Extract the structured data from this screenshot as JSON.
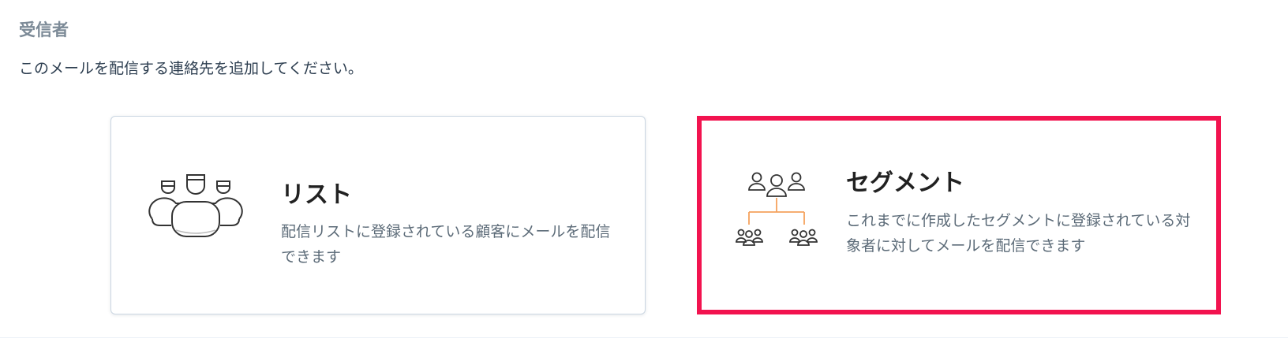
{
  "section": {
    "title": "受信者",
    "description": "このメールを配信する連絡先を追加してください。"
  },
  "options": [
    {
      "title": "リスト",
      "description": "配信リストに登録されている顧客にメールを配信できます",
      "icon": "contacts-group-icon",
      "selected": false
    },
    {
      "title": "セグメント",
      "description": "これまでに作成したセグメントに登録されている対象者に対してメールを配信できます",
      "icon": "segment-tree-icon",
      "selected": true
    }
  ],
  "colors": {
    "selected_border": "#f2134f",
    "accent_orange": "#f5a25d",
    "icon_stroke": "#333333"
  }
}
